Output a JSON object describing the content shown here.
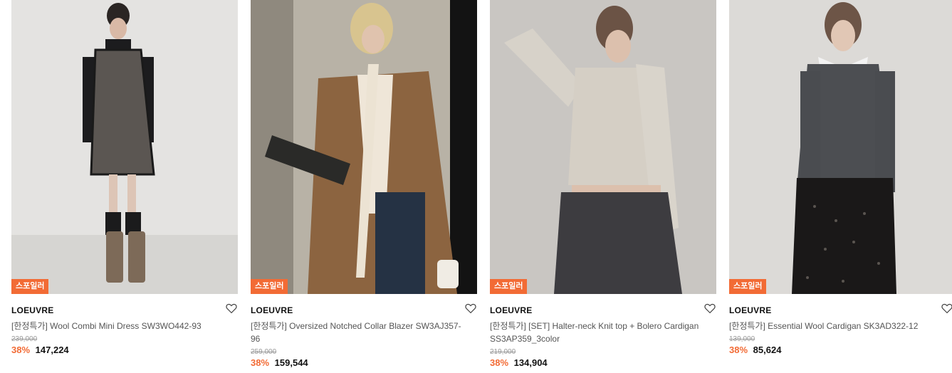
{
  "products": [
    {
      "badge": "스포일러",
      "brand": "LOEUVRE",
      "name": "[한정특가] Wool Combi Mini Dress SW3WO442-93",
      "original_price": "239,000",
      "discount_rate": "38%",
      "sale_price": "147,224"
    },
    {
      "badge": "스포일러",
      "brand": "LOEUVRE",
      "name": "[한정특가] Oversized Notched Collar Blazer SW3AJ357-96",
      "original_price": "259,000",
      "discount_rate": "38%",
      "sale_price": "159,544"
    },
    {
      "badge": "스포일러",
      "brand": "LOEUVRE",
      "name": "[한정특가] [SET] Halter-neck Knit top + Bolero Cardigan SS3AP359_3color",
      "original_price": "219,000",
      "discount_rate": "38%",
      "sale_price": "134,904"
    },
    {
      "badge": "스포일러",
      "brand": "LOEUVRE",
      "name": "[한정특가] Essential Wool Cardigan SK3AD322-12",
      "original_price": "139,000",
      "discount_rate": "38%",
      "sale_price": "85,624"
    }
  ],
  "colors": {
    "accent": "#f26b35"
  }
}
